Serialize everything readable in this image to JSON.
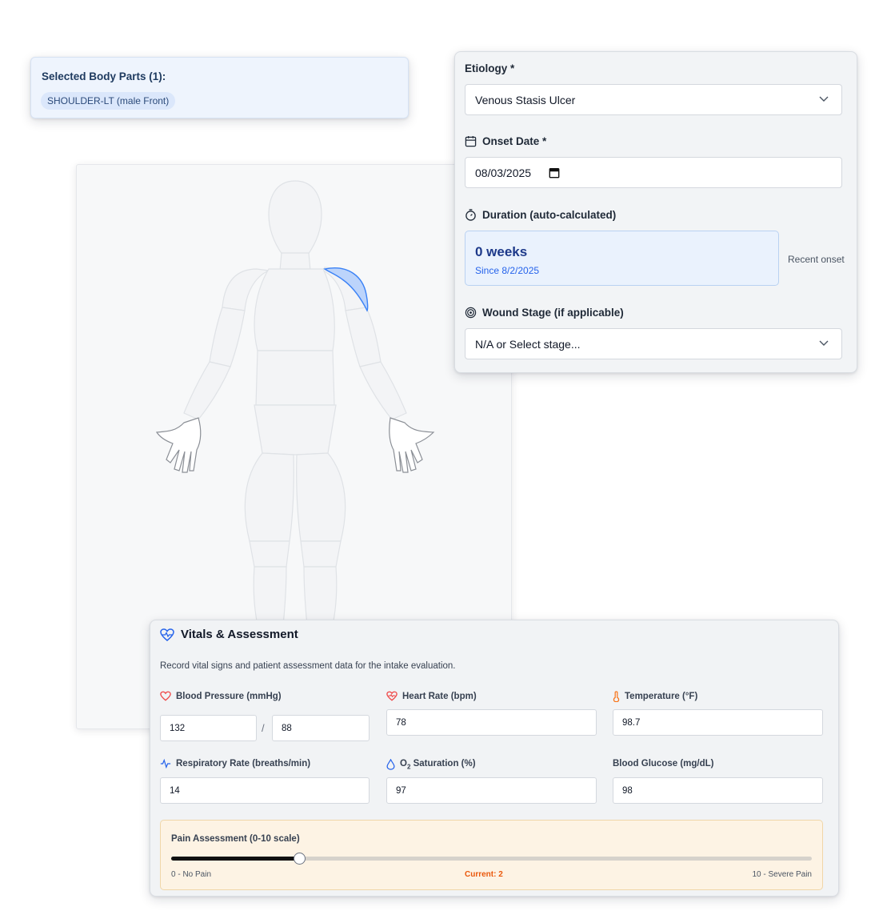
{
  "selected_parts": {
    "title": "Selected Body Parts (1):",
    "items": [
      "SHOULDER-LT (male Front)"
    ]
  },
  "body_map": {
    "view": "male front",
    "highlighted": "left shoulder",
    "highlight_color": "#bcd4fb"
  },
  "etiology": {
    "label": "Etiology *",
    "value": "Venous Stasis Ulcer",
    "icon": "chevron-down-icon"
  },
  "onset": {
    "label": "Onset Date *",
    "value": "08/03/2025",
    "icon": "calendar-icon",
    "picker_icon": "calendar-picker-icon"
  },
  "duration": {
    "label": "Duration (auto-calculated)",
    "value": "0 weeks",
    "since": "Since 8/2/2025",
    "note": "Recent onset",
    "icon": "timer-icon"
  },
  "wound_stage": {
    "label": "Wound Stage (if applicable)",
    "value": "N/A or Select stage...",
    "icon": "target-icon"
  },
  "vitals": {
    "title": "Vitals & Assessment",
    "description": "Record vital signs and patient assessment data for the intake evaluation.",
    "blood_pressure": {
      "label": "Blood Pressure (mmHg)",
      "systolic": "132",
      "separator": "/",
      "diastolic": "88"
    },
    "heart_rate": {
      "label": "Heart Rate (bpm)",
      "value": "78"
    },
    "temperature": {
      "label": "Temperature (°F)",
      "value": "98.7"
    },
    "respiratory": {
      "label": "Respiratory Rate (breaths/min)",
      "value": "14"
    },
    "o2": {
      "label_prefix": "O",
      "label_sub": "2",
      "label_suffix": " Saturation (%)",
      "value": "97"
    },
    "glucose": {
      "label": "Blood Glucose (mg/dL)",
      "value": "98"
    },
    "pain": {
      "title": "Pain Assessment (0-10 scale)",
      "min_label": "0 - No Pain",
      "max_label": "10 - Severe Pain",
      "current_label": "Current: 2",
      "value": 2,
      "max": 10
    }
  },
  "colors": {
    "accent": "#2563eb",
    "heart_red": "#ef4444",
    "temp_orange": "#f97316",
    "pain_orange": "#ea580c"
  }
}
